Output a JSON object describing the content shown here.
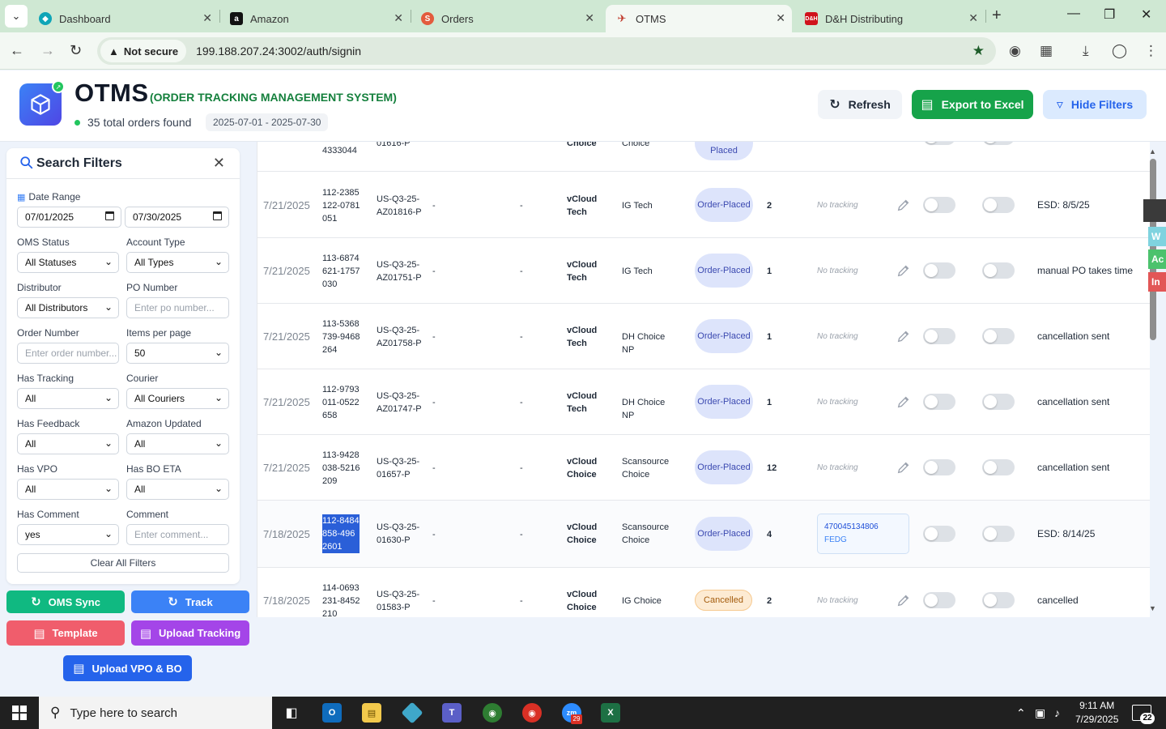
{
  "browser": {
    "tabs": [
      {
        "title": "Dashboard",
        "icon": "dashboard-favicon"
      },
      {
        "title": "Amazon",
        "icon": "amazon-favicon"
      },
      {
        "title": "Orders",
        "icon": "orders-favicon"
      },
      {
        "title": "OTMS",
        "icon": "otms-favicon"
      },
      {
        "title": "D&H Distributing",
        "icon": "dh-favicon"
      }
    ],
    "active_tab": "OTMS",
    "security_label": "Not secure",
    "url": "199.188.207.24:3002/auth/signin"
  },
  "header": {
    "title": "OTMS",
    "subtitle": "(ORDER TRACKING MANAGEMENT SYSTEM)",
    "order_count": "35 total orders found",
    "date_range": "2025-07-01 - 2025-07-30",
    "refresh_label": "Refresh",
    "export_label": "Export to Excel",
    "hide_filters_label": "Hide Filters",
    "export_color": "#16a34a"
  },
  "filters": {
    "title": "Search Filters",
    "date_range_label": "Date Range",
    "date_from": "07/01/2025",
    "date_to": "07/30/2025",
    "oms_status_label": "OMS Status",
    "oms_status_value": "All Statuses",
    "account_type_label": "Account Type",
    "account_type_value": "All Types",
    "distributor_label": "Distributor",
    "distributor_value": "All Distributors",
    "po_number_label": "PO Number",
    "po_number_placeholder": "Enter po number...",
    "order_number_label": "Order Number",
    "order_number_placeholder": "Enter order number...",
    "items_per_page_label": "Items per page",
    "items_per_page_value": "50",
    "has_tracking_label": "Has Tracking",
    "has_tracking_value": "All",
    "courier_label": "Courier",
    "courier_value": "All Couriers",
    "has_feedback_label": "Has Feedback",
    "has_feedback_value": "All",
    "amazon_updated_label": "Amazon Updated",
    "amazon_updated_value": "All",
    "has_vpo_label": "Has VPO",
    "has_vpo_value": "All",
    "has_bo_eta_label": "Has BO ETA",
    "has_bo_eta_value": "All",
    "has_comment_label": "Has Comment",
    "has_comment_value": "yes",
    "comment_label": "Comment",
    "comment_placeholder": "Enter comment...",
    "clear_all_label": "Clear All Filters"
  },
  "actions": {
    "oms_sync_label": "OMS Sync",
    "track_label": "Track",
    "template_label": "Template",
    "upload_tracking_label": "Upload Tracking",
    "upload_vpo_label": "Upload VPO & BO"
  },
  "table": {
    "partial_row": {
      "order_tail": "4333044",
      "po_tail": "01616-P",
      "distributor_tail": "Choice",
      "account_tail": "Choice",
      "status_tail": "Placed"
    },
    "rows": [
      {
        "date": "7/21/2025",
        "order": "112-2385122-0781051",
        "po": "US-Q3-25-AZ01816-P",
        "d1": "-",
        "d2": "-",
        "distributor": "vCloud Tech",
        "account": "IG Tech",
        "status": "Order-Placed",
        "items": "2",
        "tracking": "No tracking",
        "comment": "ESD:  8/5/25"
      },
      {
        "date": "7/21/2025",
        "order": "113-6874621-1757030",
        "po": "US-Q3-25-AZ01751-P",
        "d1": "-",
        "d2": "-",
        "distributor": "vCloud Tech",
        "account": "IG Tech",
        "status": "Order-Placed",
        "items": "1",
        "tracking": "No tracking",
        "comment": "manual PO takes time"
      },
      {
        "date": "7/21/2025",
        "order": "113-5368739-9468264",
        "po": "US-Q3-25-AZ01758-P",
        "d1": "-",
        "d2": "-",
        "distributor": "vCloud Tech",
        "account": "DH Choice NP",
        "status": "Order-Placed",
        "items": "1",
        "tracking": "No tracking",
        "comment": "cancellation sent"
      },
      {
        "date": "7/21/2025",
        "order": "112-9793011-0522658",
        "po": "US-Q3-25-AZ01747-P",
        "d1": "-",
        "d2": "-",
        "distributor": "vCloud Tech",
        "account": "DH Choice NP",
        "status": "Order-Placed",
        "items": "1",
        "tracking": "No tracking",
        "comment": "cancellation sent"
      },
      {
        "date": "7/21/2025",
        "order": "113-9428038-5216209",
        "po": "US-Q3-25-01657-P",
        "d1": "-",
        "d2": "-",
        "distributor": "vCloud Choice",
        "account": "Scansource Choice",
        "status": "Order-Placed",
        "items": "12",
        "tracking": "No tracking",
        "comment": "cancellation sent"
      },
      {
        "date": "7/18/2025",
        "order": "112-8484858-4962601",
        "po": "US-Q3-25-01630-P",
        "d1": "-",
        "d2": "-",
        "distributor": "vCloud Choice",
        "account": "Scansource Choice",
        "status": "Order-Placed",
        "items": "4",
        "tracking_number": "470045134806",
        "tracking_carrier": "FEDG",
        "comment": "ESD: 8/14/25"
      },
      {
        "date": "7/18/2025",
        "order": "114-0693231-8452210",
        "po": "US-Q3-25-01583-P",
        "d1": "-",
        "d2": "-",
        "distributor": "vCloud Choice",
        "account": "IG Choice",
        "status": "Cancelled",
        "items": "2",
        "tracking": "No tracking",
        "comment": "cancelled"
      }
    ]
  },
  "side_float": [
    "W",
    "Ac",
    "In"
  ],
  "taskbar": {
    "search_placeholder": "Type here to search",
    "time": "9:11 AM",
    "date": "7/29/2025",
    "notification_count": "22",
    "zoom_badge": "29"
  }
}
